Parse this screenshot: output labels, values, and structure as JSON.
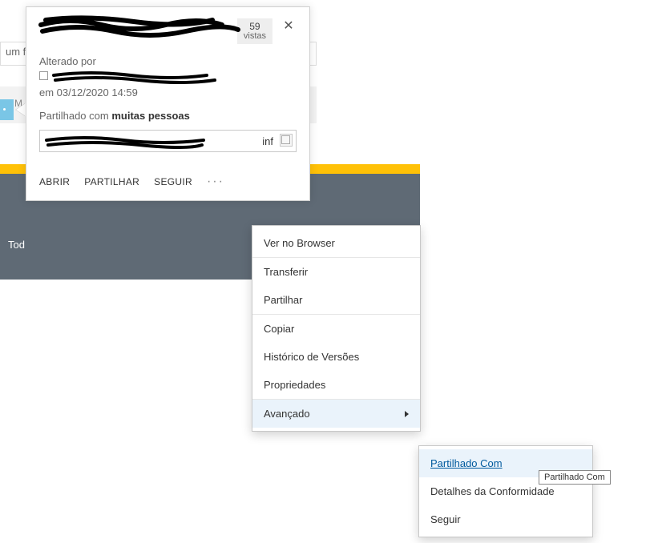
{
  "bg": {
    "searchSnippet": "um f",
    "colLetter": "M",
    "footerLeft": "Tod"
  },
  "card": {
    "titleRedacted": true,
    "views": {
      "count": "59",
      "label": "vistas"
    },
    "alteredBy": "Alterado por",
    "dateLine": "em 03/12/2020 14:59",
    "sharedPrefix": "Partilhado com ",
    "sharedBold": "muitas pessoas",
    "urlSuffix": "inf",
    "actions": {
      "open": "ABRIR",
      "share": "PARTILHAR",
      "follow": "SEGUIR",
      "more": "···"
    }
  },
  "menu1": {
    "browser": "Ver no Browser",
    "download": "Transferir",
    "share": "Partilhar",
    "copy": "Copiar",
    "versions": "Histórico de Versões",
    "properties": "Propriedades",
    "advanced": "Avançado"
  },
  "menu2": {
    "sharedWith": "Partilhado Com",
    "compliance": "Detalhes da Conformidade",
    "follow": "Seguir"
  },
  "tooltip": "Partilhado Com"
}
